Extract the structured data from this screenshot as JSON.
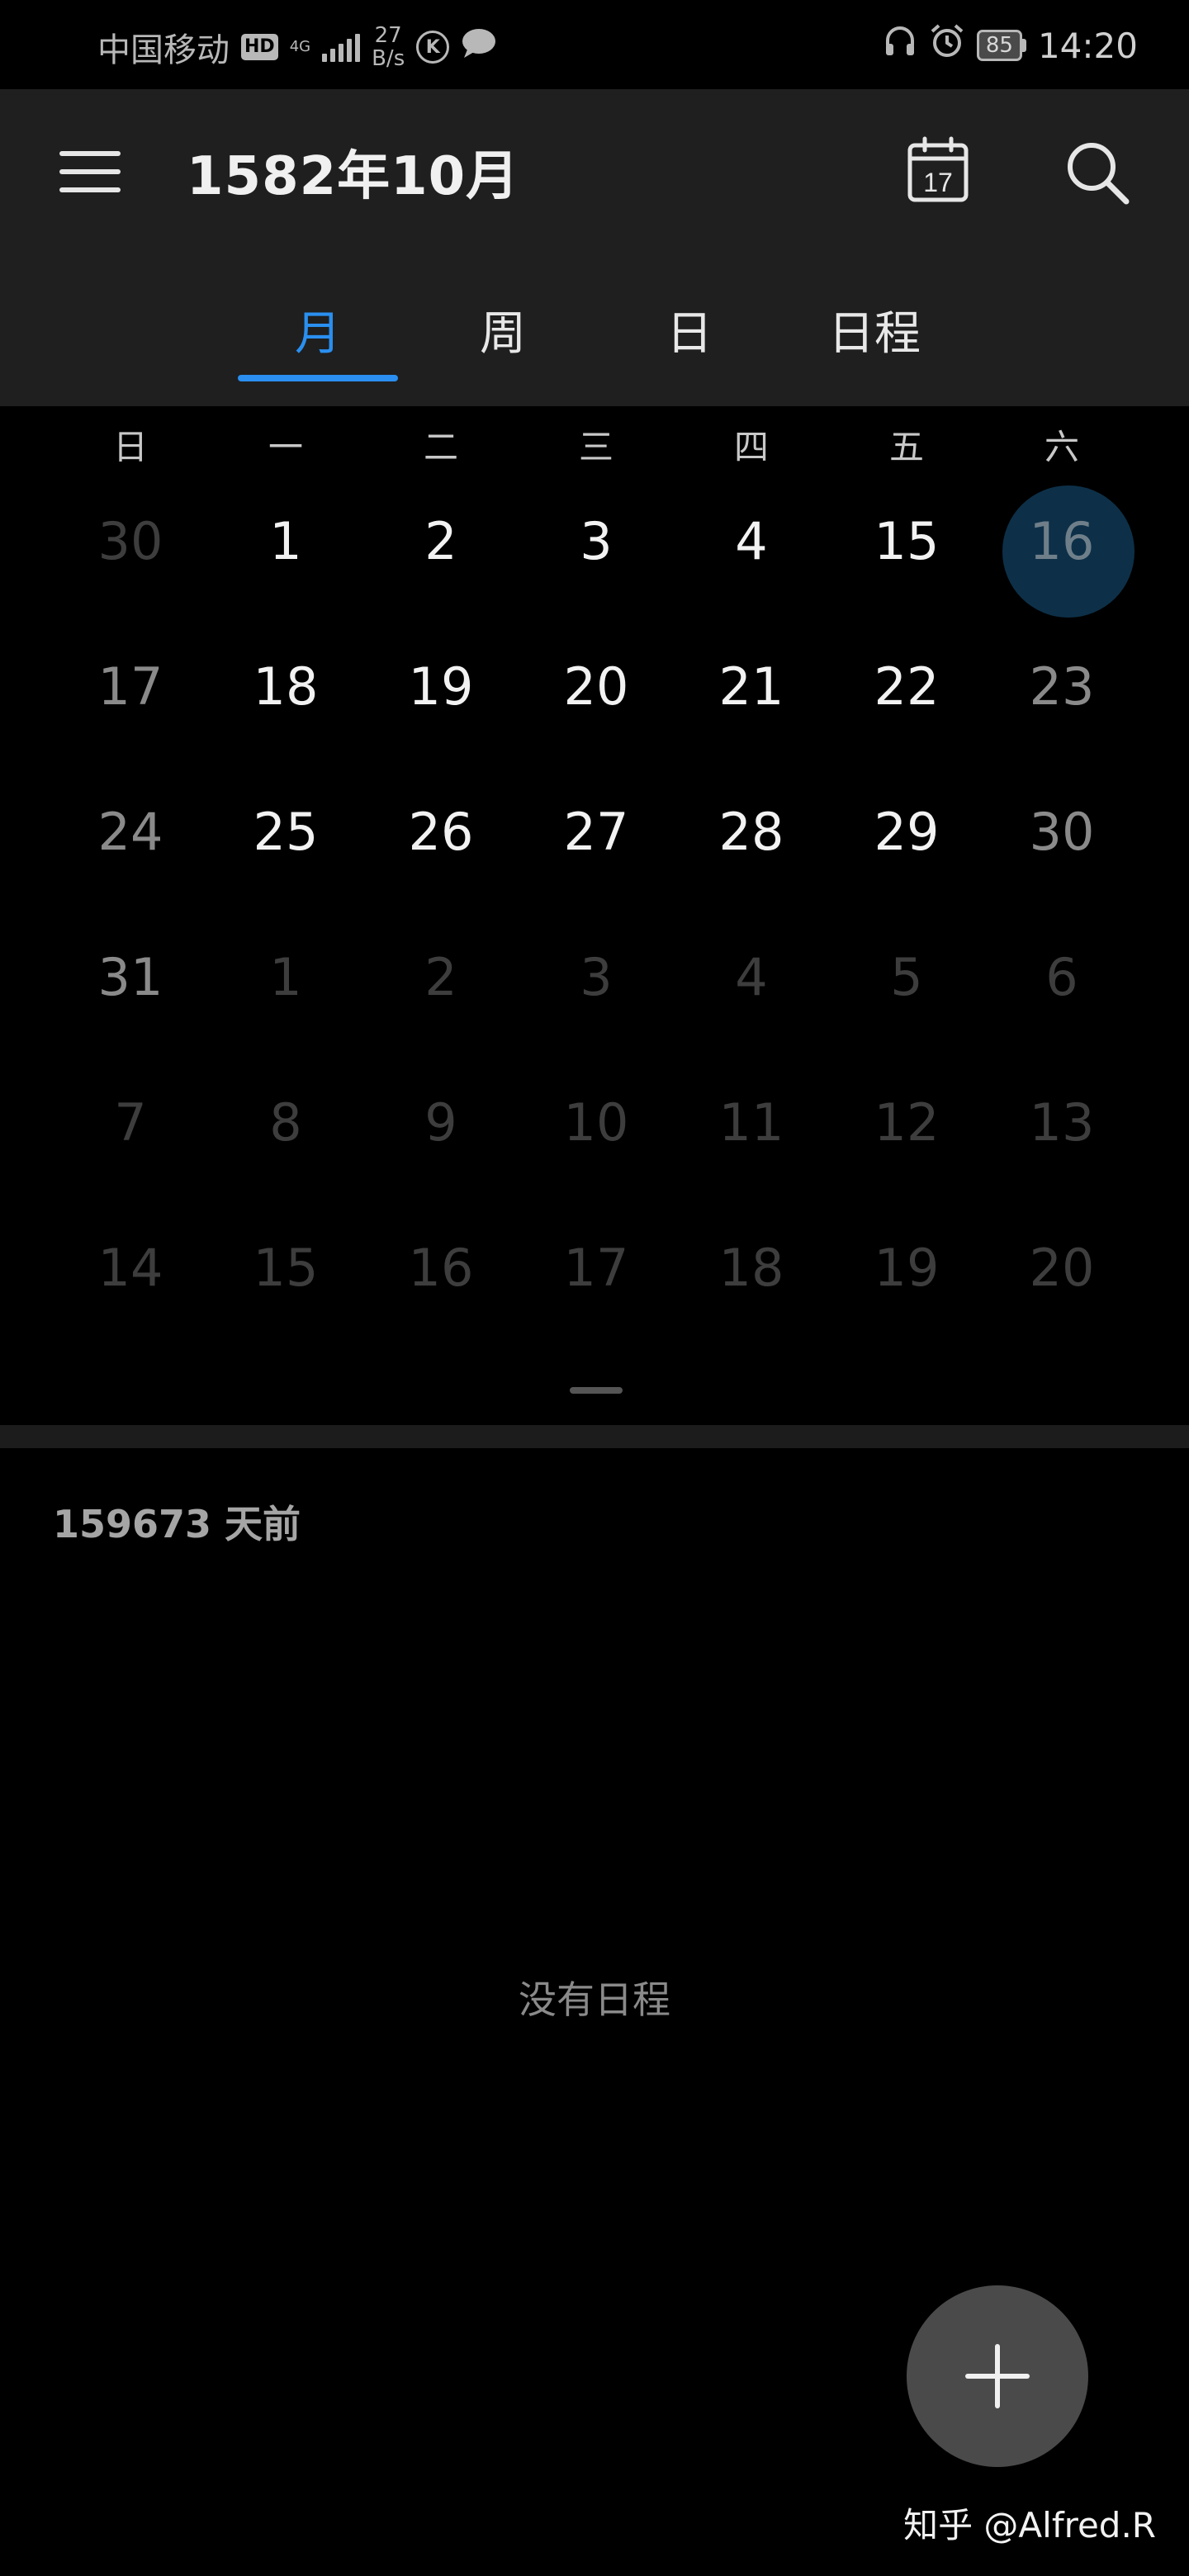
{
  "status_bar": {
    "carrier": "中国移动",
    "hd": "HD",
    "network": "4G",
    "speed_value": "27",
    "speed_unit": "B/s",
    "k_icon": "K",
    "battery": "85",
    "time": "14:20"
  },
  "header": {
    "title": "1582年10月"
  },
  "tabs": [
    {
      "label": "月",
      "active": true
    },
    {
      "label": "周",
      "active": false
    },
    {
      "label": "日",
      "active": false
    },
    {
      "label": "日程",
      "active": false
    }
  ],
  "weekdays": [
    "日",
    "一",
    "二",
    "三",
    "四",
    "五",
    "六"
  ],
  "calendar_rows": [
    [
      "30",
      "1",
      "2",
      "3",
      "4",
      "15",
      "16"
    ],
    [
      "17",
      "18",
      "19",
      "20",
      "21",
      "22",
      "23"
    ],
    [
      "24",
      "25",
      "26",
      "27",
      "28",
      "29",
      "30"
    ],
    [
      "31",
      "1",
      "2",
      "3",
      "4",
      "5",
      "6"
    ],
    [
      "7",
      "8",
      "9",
      "10",
      "11",
      "12",
      "13"
    ],
    [
      "14",
      "15",
      "16",
      "17",
      "18",
      "19",
      "20"
    ]
  ],
  "day_states": [
    [
      "other",
      "cur",
      "cur",
      "cur",
      "cur",
      "cur",
      "selected"
    ],
    [
      "weekend",
      "cur",
      "cur",
      "cur",
      "cur",
      "cur",
      "weekend"
    ],
    [
      "weekend",
      "cur",
      "cur",
      "cur",
      "cur",
      "cur",
      "weekend"
    ],
    [
      "weekend",
      "other",
      "other",
      "other",
      "other",
      "other",
      "other"
    ],
    [
      "other",
      "other",
      "other",
      "other",
      "other",
      "other",
      "other"
    ],
    [
      "other",
      "other",
      "other",
      "other",
      "other",
      "other",
      "other"
    ]
  ],
  "days_ago": "159673 天前",
  "empty_message": "没有日程",
  "watermark": "知乎 @Alfred.R",
  "colors": {
    "accent": "#2a8ff0",
    "selected_bg": "#0d3048",
    "fab_bg": "#4a4a4a"
  },
  "icons": {
    "menu": "menu-icon",
    "today": "calendar-today-icon",
    "search": "search-icon",
    "add": "plus-icon"
  }
}
